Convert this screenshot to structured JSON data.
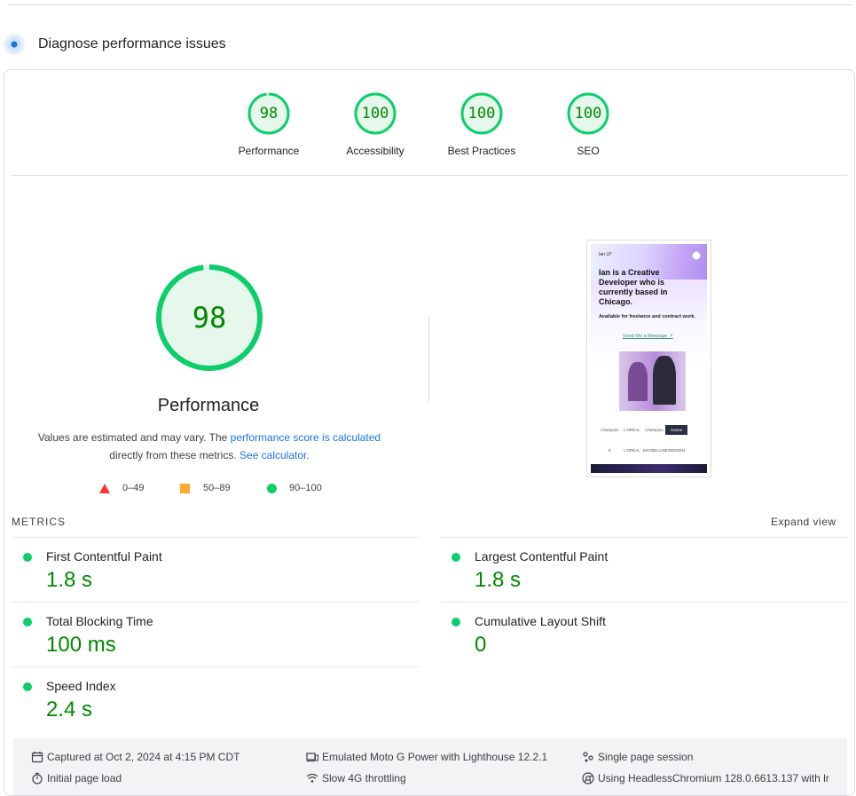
{
  "section": {
    "title": "Diagnose performance issues"
  },
  "categories": [
    {
      "name": "Performance",
      "score": "98",
      "fraction": 0.98
    },
    {
      "name": "Accessibility",
      "score": "100",
      "fraction": 1.0
    },
    {
      "name": "Best Practices",
      "score": "100",
      "fraction": 1.0
    },
    {
      "name": "SEO",
      "score": "100",
      "fraction": 1.0
    }
  ],
  "performance": {
    "score": "98",
    "fraction": 0.98,
    "title": "Performance",
    "desc_part1": "Values are estimated and may vary. The ",
    "desc_link1": "performance score is calculated",
    "desc_part2": "directly from these metrics. ",
    "desc_link2": "See calculator",
    "desc_end": "."
  },
  "legend": {
    "fail": "0–49",
    "average": "50–89",
    "pass": "90–100"
  },
  "screenshot": {
    "brand": "Ian LP",
    "headline": "Ian is a Creative Developer who is currently based in Chicago.",
    "sub": "Available for freelance and contract work.",
    "cta": "Send Me a Message ↗",
    "logos": [
      "Champion",
      "L'ORÉAL",
      "Champion",
      "Hanes",
      "K",
      "L'ORÉAL",
      "MAYBELLINE",
      "REDKEN"
    ]
  },
  "metrics": {
    "title": "METRICS",
    "expand_label": "Expand view",
    "items": [
      {
        "name": "First Contentful Paint",
        "value": "1.8 s"
      },
      {
        "name": "Largest Contentful Paint",
        "value": "1.8 s"
      },
      {
        "name": "Total Blocking Time",
        "value": "100 ms"
      },
      {
        "name": "Cumulative Layout Shift",
        "value": "0"
      },
      {
        "name": "Speed Index",
        "value": "2.4 s"
      }
    ]
  },
  "info": {
    "captured": "Captured at Oct 2, 2024 at 4:15 PM CDT",
    "initial": "Initial page load",
    "device": "Emulated Moto G Power with Lighthouse 12.2.1",
    "throttling": "Slow 4G throttling",
    "session": "Single page session",
    "browser": "Using HeadlessChromium 128.0.6613.137 with lr"
  },
  "colors": {
    "pass": "#0cce6b",
    "pass_text": "#008800",
    "average": "#ffaa33",
    "fail": "#ff3333",
    "link": "#1a73e8"
  }
}
